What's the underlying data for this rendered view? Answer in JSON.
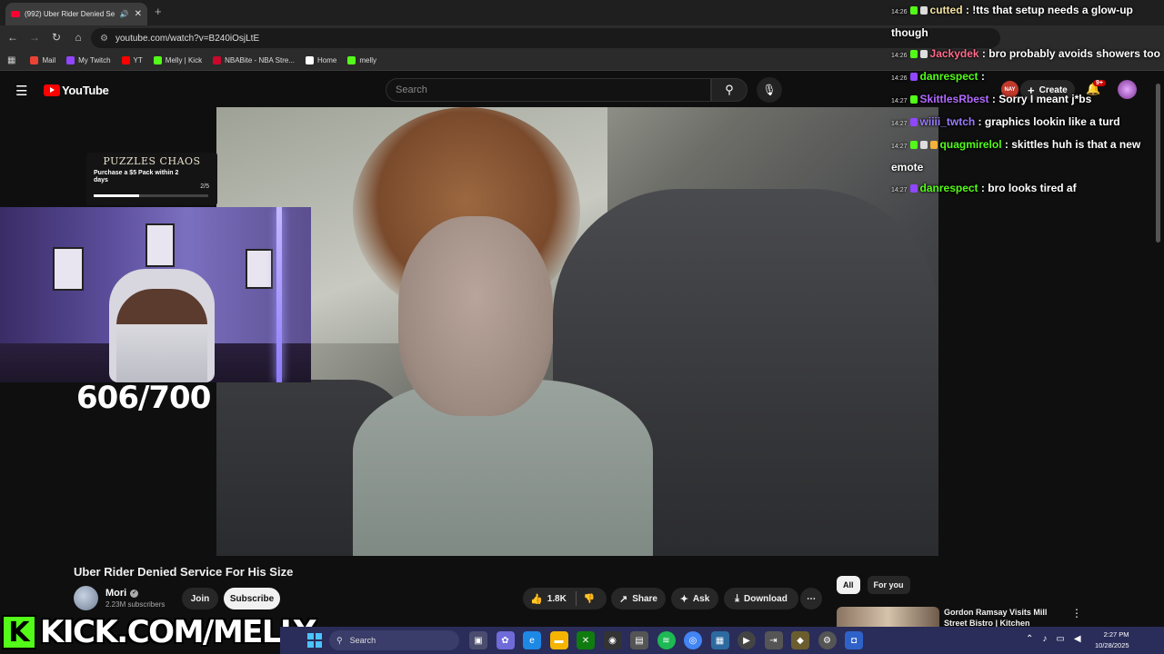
{
  "browser": {
    "tab_title": "(992) Uber Rider Denied Se",
    "url": "youtube.com/watch?v=B240iOsjLtE",
    "bookmarks": [
      {
        "label": "Mail",
        "color": "#ea4335"
      },
      {
        "label": "My Twitch",
        "color": "#9146ff"
      },
      {
        "label": "YT",
        "color": "#ff0000"
      },
      {
        "label": "Melly | Kick",
        "color": "#53fc18"
      },
      {
        "label": "NBABite - NBA Stre...",
        "color": "#c9082a"
      },
      {
        "label": "Home",
        "color": "#ffffff"
      },
      {
        "label": "melly",
        "color": "#53fc18"
      }
    ]
  },
  "youtube": {
    "logo_text": "YouTube",
    "search_placeholder": "Search",
    "create_label": "Create",
    "nay_badge": "NAY",
    "notification_count": "9+"
  },
  "video": {
    "title": "Uber Rider Denied Service For His Size",
    "channel_name": "Mori",
    "subscribers": "2.23M subscribers",
    "join_label": "Join",
    "subscribe_label": "Subscribe",
    "likes": "1.8K",
    "share_label": "Share",
    "ask_label": "Ask",
    "download_label": "Download"
  },
  "chips": [
    {
      "label": "All",
      "active": true
    },
    {
      "label": "For you",
      "active": false
    }
  ],
  "recommendation": {
    "title": "Gordon Ramsay Visits Mill Street Bistro | Kitchen"
  },
  "overlay": {
    "promo_logo": "PUZZLES CHAOS",
    "promo_text": "Purchase a $5 Pack within 2 days",
    "promo_count": "2/5",
    "promo_progress": 0.4,
    "goal_text": "606/700",
    "kick_letter": "K",
    "kick_banner": "KICK.COM/MELLY"
  },
  "chat": [
    {
      "time": "14:26",
      "user": "cutted",
      "user_color": "#f4e3a0",
      "badges": [
        "kick",
        "sub"
      ],
      "text": "!tts that setup needs a glow-up though"
    },
    {
      "time": "14:26",
      "user": "Jackydek",
      "user_color": "#ff6b8a",
      "badges": [
        "kick",
        "sub"
      ],
      "text": "bro probably avoids showers too"
    },
    {
      "time": "14:26",
      "user": "danrespect",
      "user_color": "#53fc18",
      "badges": [
        "twitch"
      ],
      "text": ""
    },
    {
      "time": "14:27",
      "user": "SkittlesRbest",
      "user_color": "#b26bff",
      "badges": [
        "kick"
      ],
      "text": "Sorry I meant j*bs"
    },
    {
      "time": "14:27",
      "user": "wiiii_twtch",
      "user_color": "#9b7bff",
      "badges": [
        "twitch"
      ],
      "text": "graphics lookin like a turd"
    },
    {
      "time": "14:27",
      "user": "quagmirelol",
      "user_color": "#53fc18",
      "badges": [
        "kick",
        "sub",
        "gift"
      ],
      "text": "skittles huh is that a new emote"
    },
    {
      "time": "14:27",
      "user": "danrespect",
      "user_color": "#53fc18",
      "badges": [
        "twitch"
      ],
      "text": "bro looks tired af"
    }
  ],
  "taskbar": {
    "search_label": "Search",
    "time": "2:27 PM",
    "date": "10/28/2025"
  }
}
